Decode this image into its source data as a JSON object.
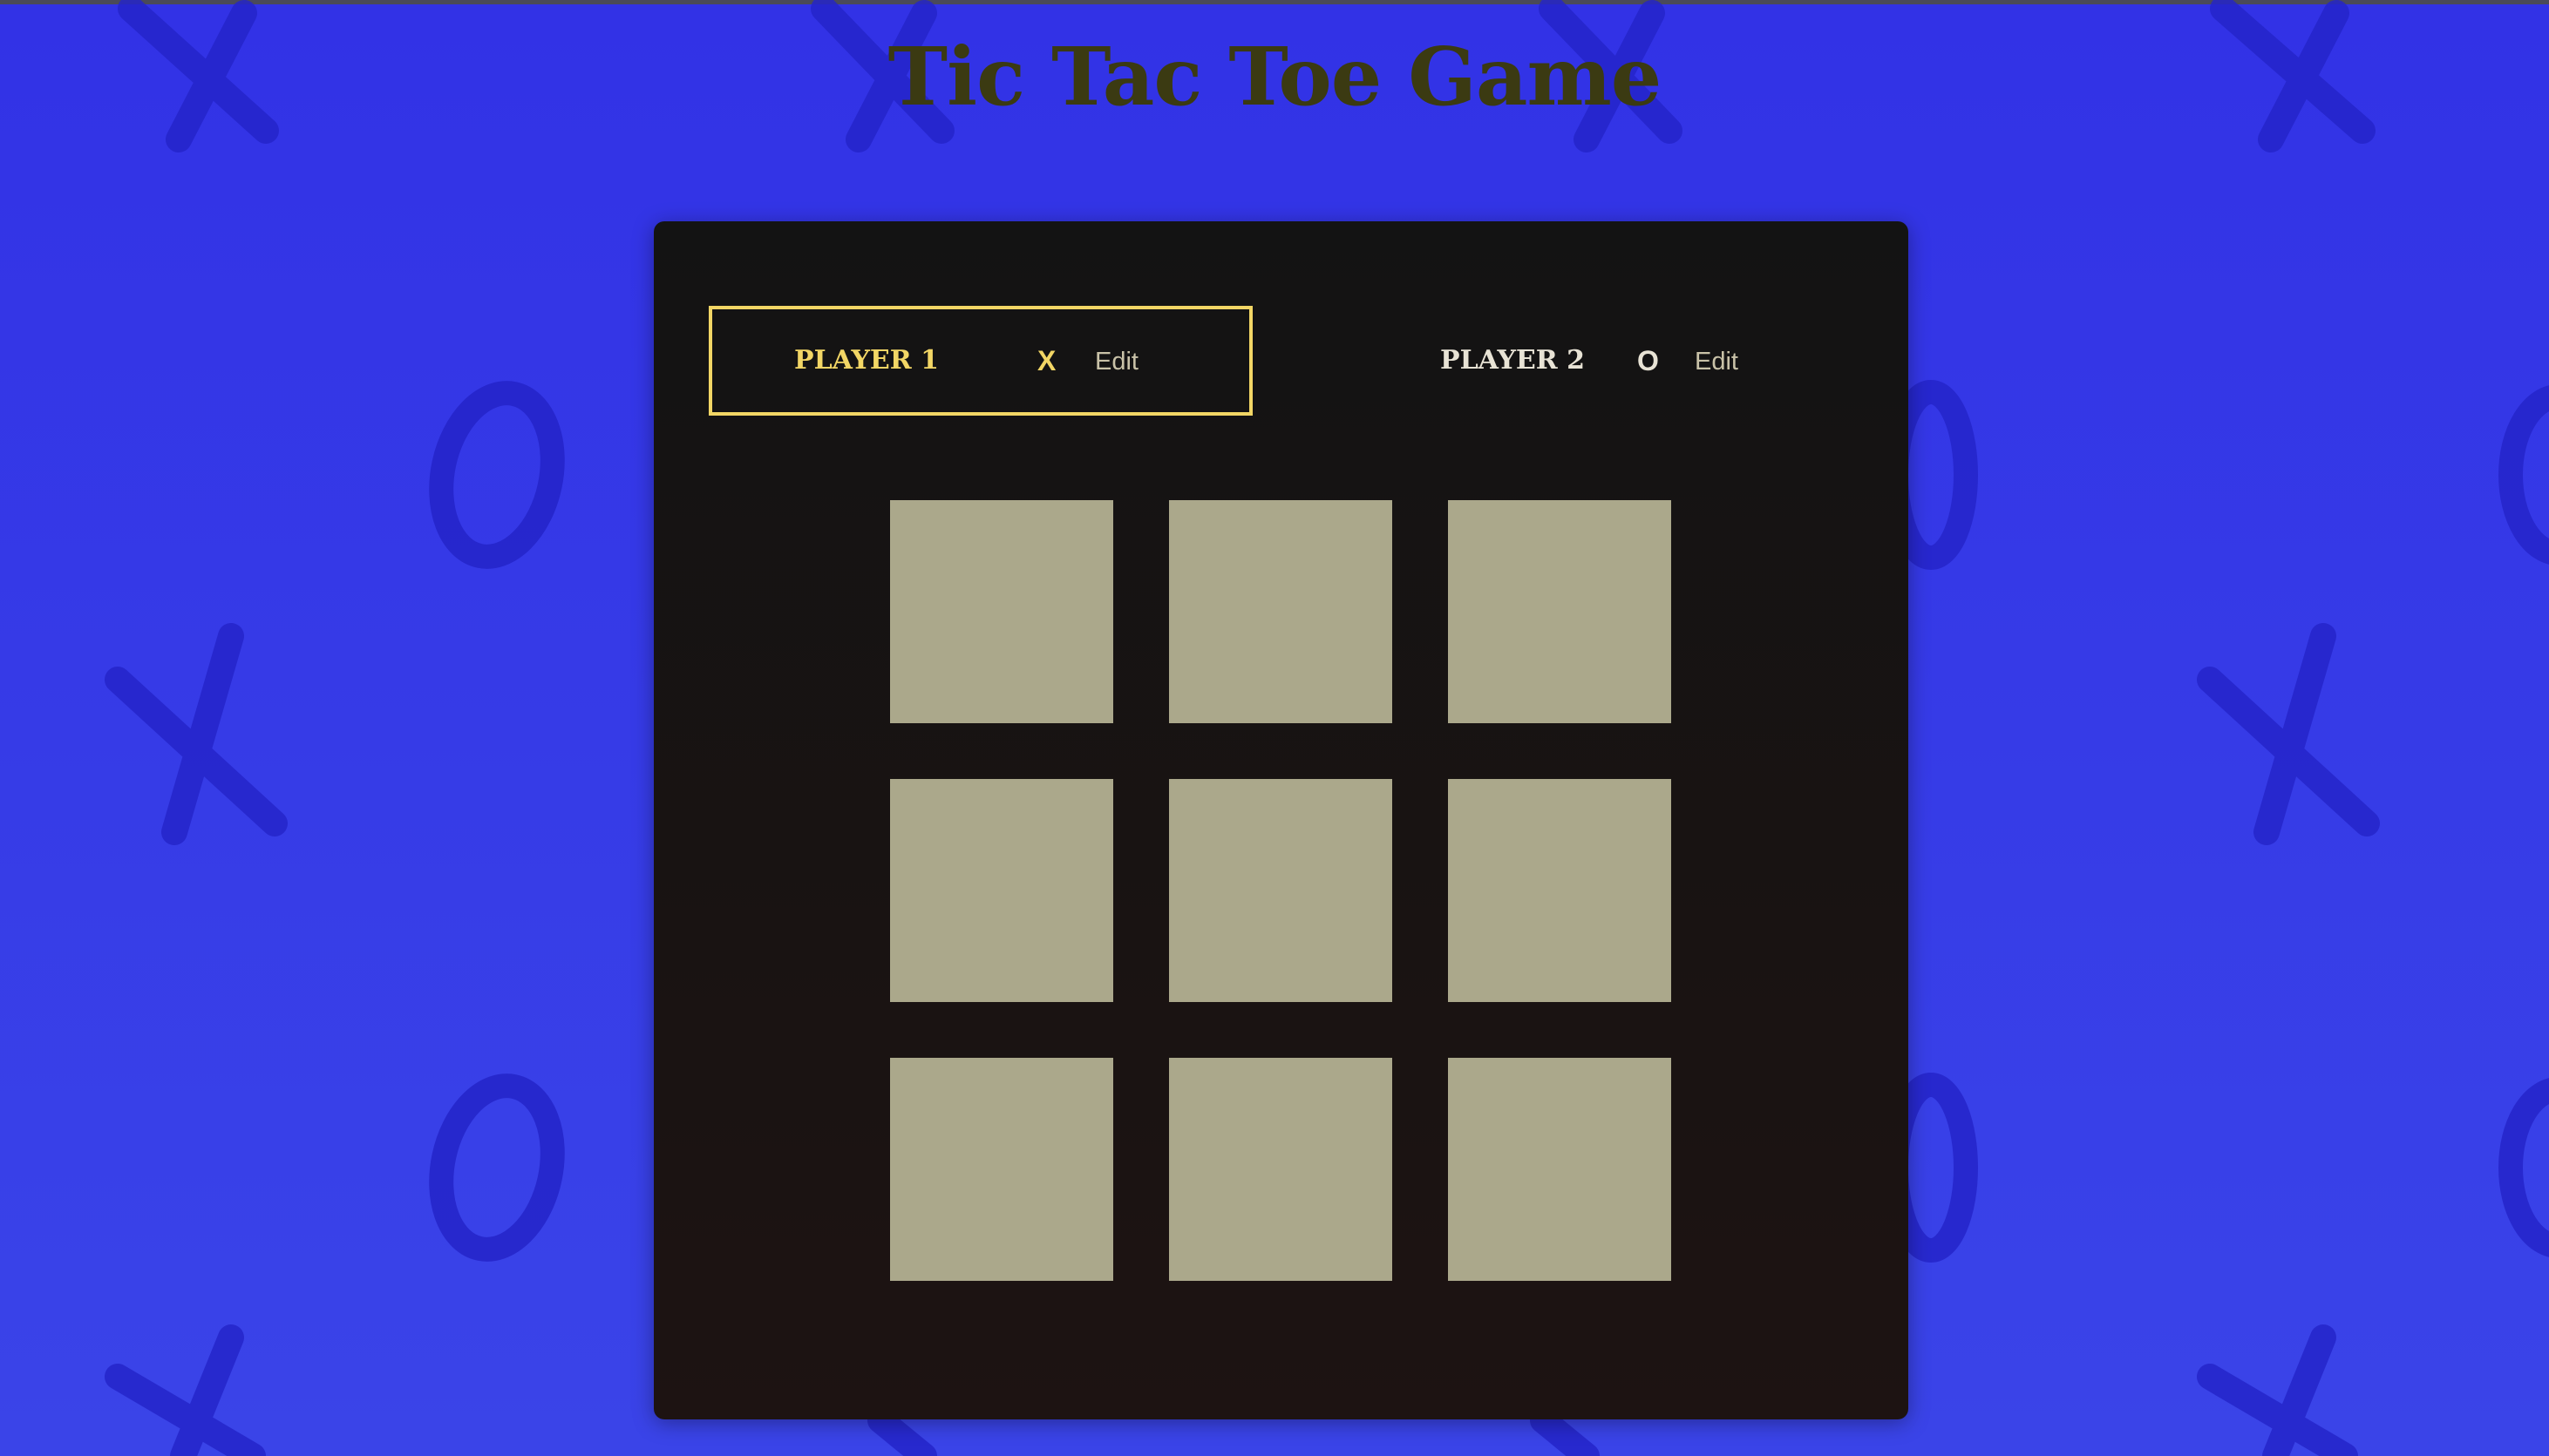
{
  "page": {
    "title": "Tic Tac Toe Game"
  },
  "players": [
    {
      "name": "PLAYER 1",
      "symbol": "X",
      "edit_label": "Edit",
      "active": true
    },
    {
      "name": "PLAYER 2",
      "symbol": "O",
      "edit_label": "Edit",
      "active": false
    }
  ],
  "board": {
    "cells": [
      "",
      "",
      "",
      "",
      "",
      "",
      "",
      "",
      ""
    ]
  },
  "colors": {
    "background": "#3232e6",
    "pattern": "#2222c8",
    "panel": "#131313",
    "active_accent": "#f2d665",
    "cell": "#aba88b",
    "title": "#3b3a12"
  }
}
